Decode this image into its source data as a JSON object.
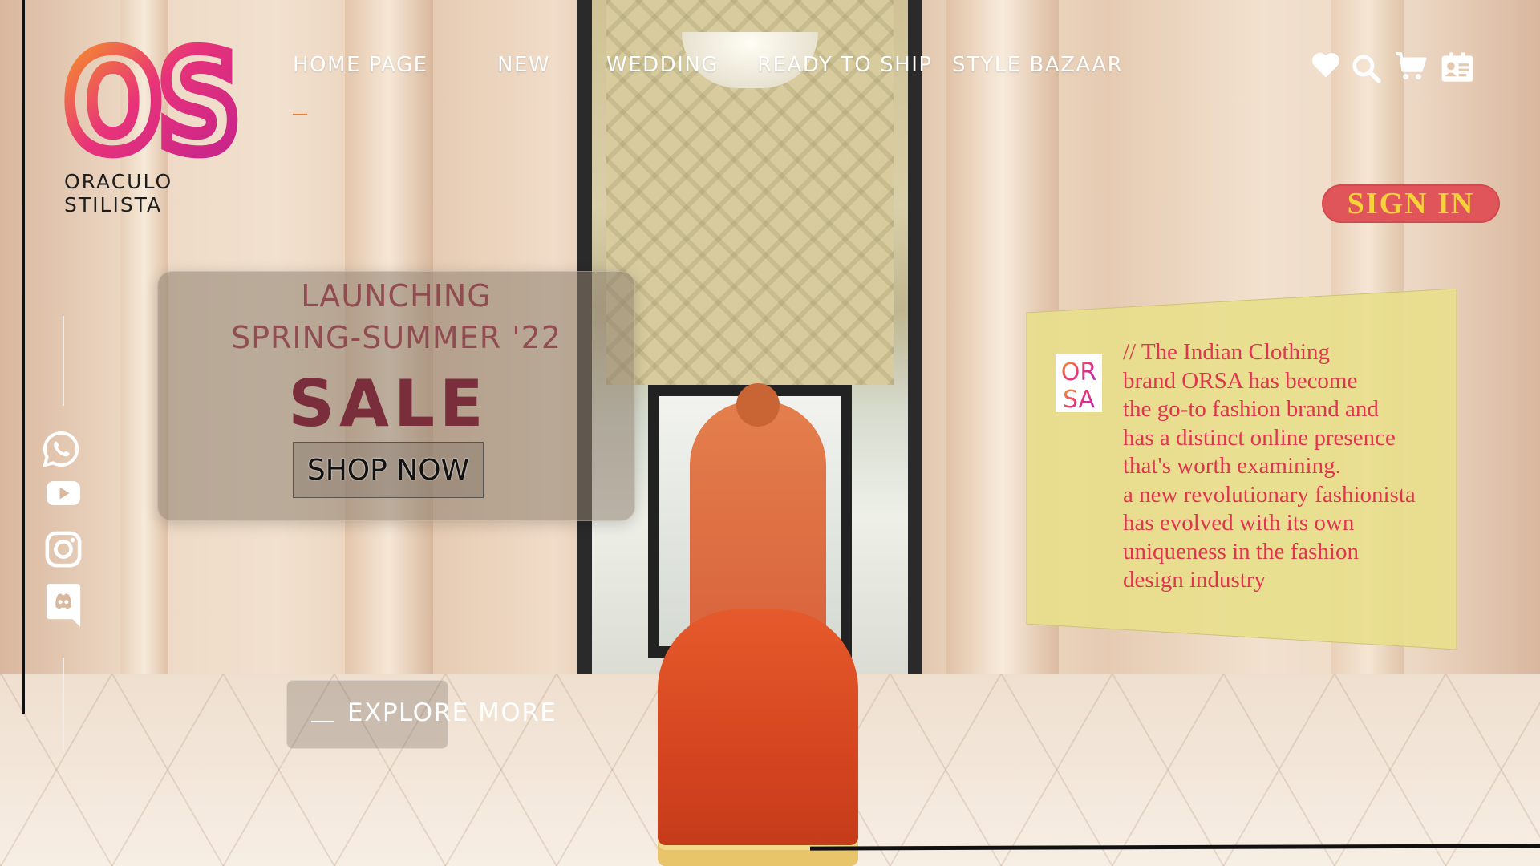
{
  "brand": {
    "logo_letters": "OS",
    "name": "ORACULO STILISTA"
  },
  "nav": {
    "items": [
      {
        "label": "HOME PAGE",
        "active": true
      },
      {
        "label": "NEW"
      },
      {
        "label": "WEDDING"
      },
      {
        "label": "READY TO SHIP"
      },
      {
        "label": "STYLE BAZAAR"
      }
    ],
    "active_color": "#f07d2e"
  },
  "header_icons": [
    "heart-icon",
    "search-icon",
    "cart-icon",
    "contact-card-icon"
  ],
  "signin": {
    "label": "SIGN IN",
    "bg_color": "#e0555a",
    "text_color": "#f7d23b"
  },
  "promo": {
    "line1": "LAUNCHING",
    "line2": "SPRING-SUMMER '22",
    "headline": "SALE",
    "cta": "SHOP NOW"
  },
  "explore": {
    "label": "EXPLORE MORE"
  },
  "social_icons": [
    "whatsapp-icon",
    "youtube-icon",
    "instagram-icon",
    "discord-icon"
  ],
  "quote": {
    "logo_text_top": "OR",
    "logo_text_bottom": "SA",
    "lines": [
      "// The Indian Clothing",
      "brand ORSA has become",
      "the go-to fashion brand and",
      "has a distinct online presence",
      "that's worth examining.",
      "a new revolutionary fashionista",
      "has evolved with its own",
      "uniqueness in the fashion",
      "design industry"
    ],
    "text_color": "#e0354f",
    "card_color": "#e8de8c"
  }
}
